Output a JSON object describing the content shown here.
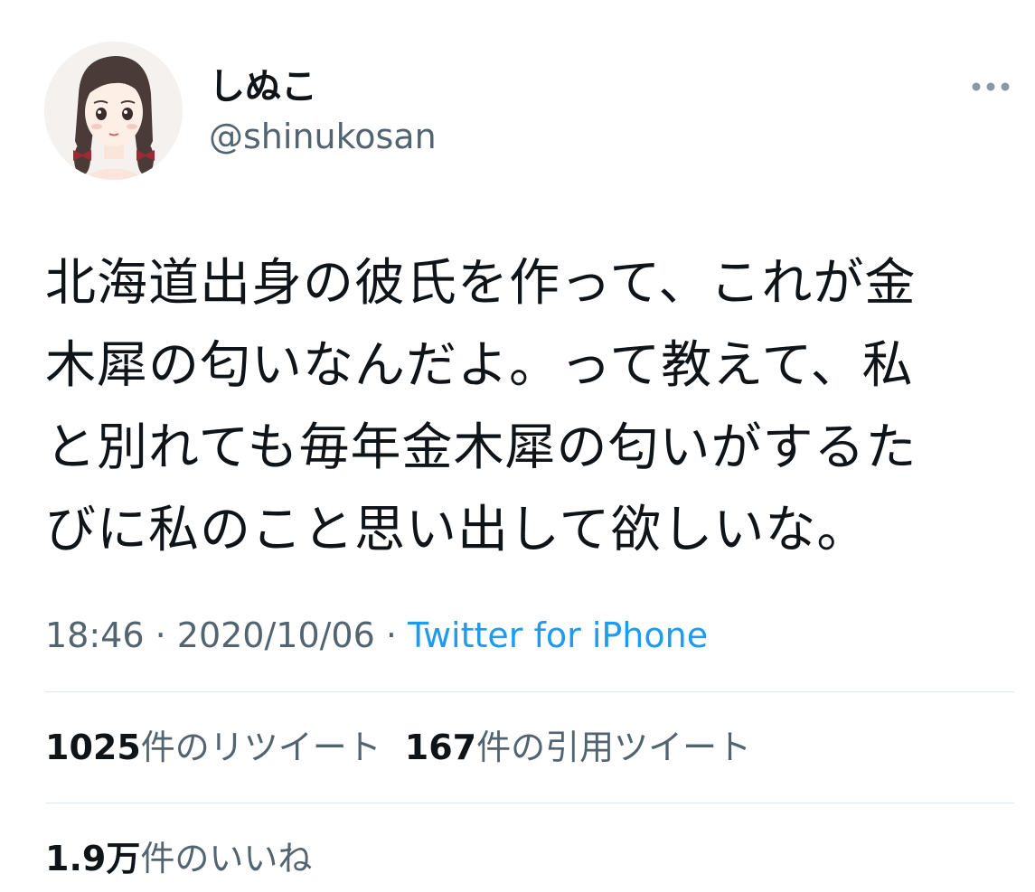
{
  "user": {
    "display_name": "しぬこ",
    "handle": "@shinukosan",
    "avatar_icon": "avatar-illustration"
  },
  "more_icon": "more-horizontal-icon",
  "tweet": {
    "text": "北海道出身の彼氏を作って、これが金\n木犀の匂いなんだよ。って教えて、私\nと別れても毎年金木犀の匂いがするた\nびに私のこと思い出して欲しいな。"
  },
  "meta": {
    "time": "18:46",
    "separator1": " · ",
    "date": "2020/10/06",
    "separator2": " · ",
    "source": "Twitter for iPhone"
  },
  "stats": {
    "retweets_count": "1025",
    "retweets_label": "件のリツイート",
    "quotes_count": "167",
    "quotes_label": "件の引用ツイート",
    "likes_count": "1.9万",
    "likes_label": "件のいいね"
  },
  "colors": {
    "text_primary": "#0f1419",
    "text_secondary": "#536471",
    "link": "#1d9bf0",
    "divider": "#e1e8ed"
  }
}
